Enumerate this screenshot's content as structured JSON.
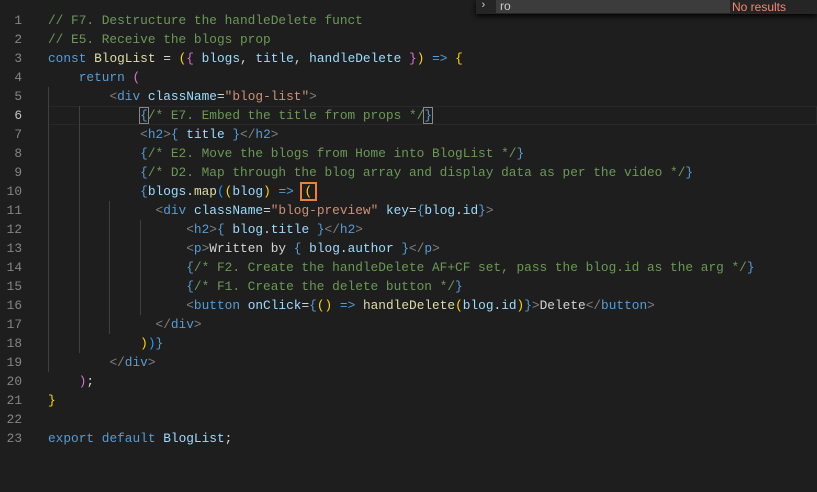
{
  "find_widget": {
    "query": "ro",
    "status": "No results",
    "toggle_icon": "chevron-right-icon"
  },
  "colors": {
    "background": "#1e1e1e",
    "keyword": "#569cd6",
    "comment": "#6a9955",
    "variable": "#9cdcfe",
    "function": "#dcdcaa",
    "string": "#ce9178",
    "cursor_box": "#e8823b"
  },
  "active_line": 6,
  "lines": [
    [
      [
        "// F7. Destructure the handleDelete funct",
        "cm"
      ]
    ],
    [
      [
        "// E5. Receive the blogs prop",
        "cm"
      ]
    ],
    [
      [
        "const",
        "kw"
      ],
      [
        " "
      ],
      [
        "BlogList",
        "fn"
      ],
      [
        " = "
      ],
      [
        "(",
        "br"
      ],
      [
        "{",
        "br2"
      ],
      [
        " "
      ],
      [
        "blogs",
        "var"
      ],
      [
        ", "
      ],
      [
        "title",
        "var"
      ],
      [
        ", "
      ],
      [
        "handleDelete",
        "var"
      ],
      [
        " "
      ],
      [
        "}",
        "br2"
      ],
      [
        ")",
        "br"
      ],
      [
        " "
      ],
      [
        "=>",
        "kw"
      ],
      [
        " "
      ],
      [
        "{",
        "br"
      ]
    ],
    [
      [
        "    "
      ],
      [
        "return",
        "kw"
      ],
      [
        " "
      ],
      [
        "(",
        "br2"
      ]
    ],
    [
      [
        "        "
      ],
      [
        "<",
        "pn"
      ],
      [
        "div",
        "tag"
      ],
      [
        " "
      ],
      [
        "className",
        "attr"
      ],
      [
        "="
      ],
      [
        "\"blog-list\"",
        "str"
      ],
      [
        ">",
        "pn"
      ]
    ],
    [
      [
        "            "
      ],
      [
        "{",
        "kw match"
      ],
      [
        "/* E7. Embed the title from props */",
        "cm"
      ],
      [
        "}",
        "kw match"
      ]
    ],
    [
      [
        "            "
      ],
      [
        "<",
        "pn"
      ],
      [
        "h2",
        "tag"
      ],
      [
        ">",
        "pn"
      ],
      [
        "{",
        "kw"
      ],
      [
        " "
      ],
      [
        "title",
        "var"
      ],
      [
        " "
      ],
      [
        "}",
        "kw"
      ],
      [
        "</",
        "pn"
      ],
      [
        "h2",
        "tag"
      ],
      [
        ">",
        "pn"
      ]
    ],
    [
      [
        "            "
      ],
      [
        "{",
        "kw"
      ],
      [
        "/* E2. Move the blogs from Home into BlogList */",
        "cm"
      ],
      [
        "}",
        "kw"
      ]
    ],
    [
      [
        "            "
      ],
      [
        "{",
        "kw"
      ],
      [
        "/* D2. Map through the blog array and display data as per the video */",
        "cm"
      ],
      [
        "}",
        "kw"
      ]
    ],
    [
      [
        "            "
      ],
      [
        "{",
        "kw"
      ],
      [
        "blogs",
        "var"
      ],
      [
        "."
      ],
      [
        "map",
        "fn"
      ],
      [
        "(",
        "br3"
      ],
      [
        "(",
        "br"
      ],
      [
        "blog",
        "var"
      ],
      [
        ")",
        "br"
      ],
      [
        " "
      ],
      [
        "=>",
        "kw"
      ],
      [
        " "
      ],
      [
        "(",
        "br box"
      ]
    ],
    [
      [
        "              "
      ],
      [
        "<",
        "pn"
      ],
      [
        "div",
        "tag"
      ],
      [
        " "
      ],
      [
        "className",
        "attr"
      ],
      [
        "="
      ],
      [
        "\"blog-preview\"",
        "str"
      ],
      [
        " "
      ],
      [
        "key",
        "attr"
      ],
      [
        "="
      ],
      [
        "{",
        "kw"
      ],
      [
        "blog",
        "var"
      ],
      [
        "."
      ],
      [
        "id",
        "var"
      ],
      [
        "}",
        "kw"
      ],
      [
        ">",
        "pn"
      ]
    ],
    [
      [
        "                  "
      ],
      [
        "<",
        "pn"
      ],
      [
        "h2",
        "tag"
      ],
      [
        ">",
        "pn"
      ],
      [
        "{",
        "kw"
      ],
      [
        " "
      ],
      [
        "blog",
        "var"
      ],
      [
        "."
      ],
      [
        "title",
        "var"
      ],
      [
        " "
      ],
      [
        "}",
        "kw"
      ],
      [
        "</",
        "pn"
      ],
      [
        "h2",
        "tag"
      ],
      [
        ">",
        "pn"
      ]
    ],
    [
      [
        "                  "
      ],
      [
        "<",
        "pn"
      ],
      [
        "p",
        "tag"
      ],
      [
        ">",
        "pn"
      ],
      [
        "Written by "
      ],
      [
        "{",
        "kw"
      ],
      [
        " "
      ],
      [
        "blog",
        "var"
      ],
      [
        "."
      ],
      [
        "author",
        "var"
      ],
      [
        " "
      ],
      [
        "}",
        "kw"
      ],
      [
        "</",
        "pn"
      ],
      [
        "p",
        "tag"
      ],
      [
        ">",
        "pn"
      ]
    ],
    [
      [
        "                  "
      ],
      [
        "{",
        "kw"
      ],
      [
        "/* F2. Create the handleDelete AF+CF set, pass the blog.id as the arg */",
        "cm"
      ],
      [
        "}",
        "kw"
      ]
    ],
    [
      [
        "                  "
      ],
      [
        "{",
        "kw"
      ],
      [
        "/* F1. Create the delete button */",
        "cm"
      ],
      [
        "}",
        "kw"
      ]
    ],
    [
      [
        "                  "
      ],
      [
        "<",
        "pn"
      ],
      [
        "button",
        "tag"
      ],
      [
        " "
      ],
      [
        "onClick",
        "attr"
      ],
      [
        "="
      ],
      [
        "{",
        "kw"
      ],
      [
        "(",
        "br"
      ],
      [
        ")",
        "br"
      ],
      [
        " "
      ],
      [
        "=>",
        "kw"
      ],
      [
        " "
      ],
      [
        "handleDelete",
        "fn"
      ],
      [
        "(",
        "br"
      ],
      [
        "blog",
        "var"
      ],
      [
        "."
      ],
      [
        "id",
        "var"
      ],
      [
        ")",
        "br"
      ],
      [
        "}",
        "kw"
      ],
      [
        ">",
        "pn"
      ],
      [
        "Delete"
      ],
      [
        "</",
        "pn"
      ],
      [
        "button",
        "tag"
      ],
      [
        ">",
        "pn"
      ]
    ],
    [
      [
        "              "
      ],
      [
        "</",
        "pn"
      ],
      [
        "div",
        "tag"
      ],
      [
        ">",
        "pn"
      ]
    ],
    [
      [
        "            "
      ],
      [
        ")",
        "br"
      ],
      [
        ")",
        "br3"
      ],
      [
        "}",
        "kw"
      ]
    ],
    [
      [
        "        "
      ],
      [
        "</",
        "pn"
      ],
      [
        "div",
        "tag"
      ],
      [
        ">",
        "pn"
      ]
    ],
    [
      [
        "    "
      ],
      [
        ")",
        "br2"
      ],
      [
        ";"
      ]
    ],
    [
      [
        "}",
        "br"
      ]
    ],
    [],
    [
      [
        "export",
        "kw"
      ],
      [
        " "
      ],
      [
        "default",
        "kw"
      ],
      [
        " "
      ],
      [
        "BlogList",
        "var"
      ],
      [
        ";"
      ]
    ]
  ]
}
